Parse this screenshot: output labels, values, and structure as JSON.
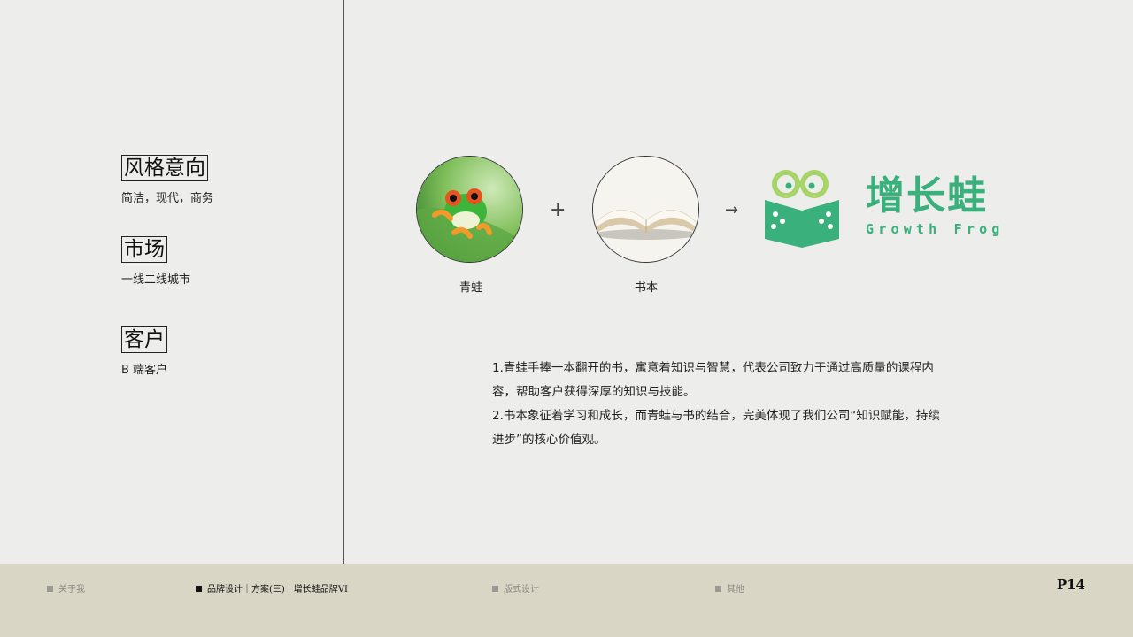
{
  "left": {
    "sections": [
      {
        "heading": "风格意向",
        "sub": "简洁，现代，商务"
      },
      {
        "heading": "市场",
        "sub": "一线二线城市"
      },
      {
        "heading": "客户",
        "sub": "B 端客户"
      }
    ]
  },
  "concept": {
    "frog_caption": "青蛙",
    "book_caption": "书本",
    "plus": "+",
    "arrow": "→"
  },
  "brand": {
    "name_cn": "增长蛙",
    "name_en": "Growth Frog",
    "color": "#3ab07c",
    "glasses_color": "#a9d46a"
  },
  "description": [
    "1.青蛙手捧一本翻开的书，寓意着知识与智慧，代表公司致力于通过高质量的课程内容，帮助客户获得深厚的知识与技能。",
    "2.书本象征着学习和成长，而青蛙与书的结合，完美体现了我们公司“知识赋能，持续进步”的核心价值观。"
  ],
  "footer": {
    "nav": [
      {
        "label": "关于我",
        "active": false
      },
      {
        "label": "品牌设计｜方案(三)｜增长蛙品牌VI",
        "active": true
      },
      {
        "label": "版式设计",
        "active": false
      },
      {
        "label": "其他",
        "active": false
      }
    ],
    "page": "P14"
  }
}
